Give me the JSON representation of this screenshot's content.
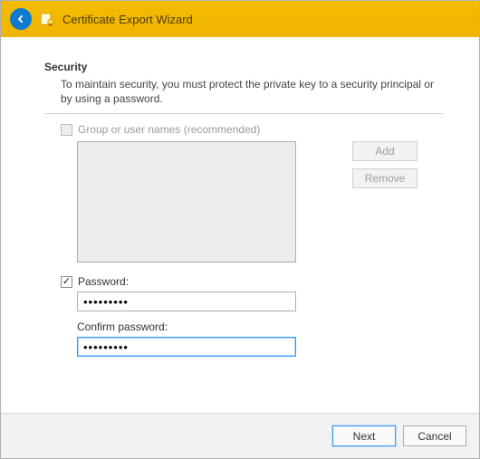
{
  "header": {
    "title": "Certificate Export Wizard"
  },
  "security": {
    "heading": "Security",
    "description": "To maintain security, you must protect the private key to a security principal or by using a password."
  },
  "group_option": {
    "label": "Group or user names (recommended)",
    "checked": false,
    "enabled": false
  },
  "buttons": {
    "add": "Add",
    "remove": "Remove",
    "next": "Next",
    "cancel": "Cancel"
  },
  "password_option": {
    "label": "Password:",
    "checked": true,
    "value": "•••••••••",
    "confirm_label": "Confirm password:",
    "confirm_value": "•••••••••"
  }
}
